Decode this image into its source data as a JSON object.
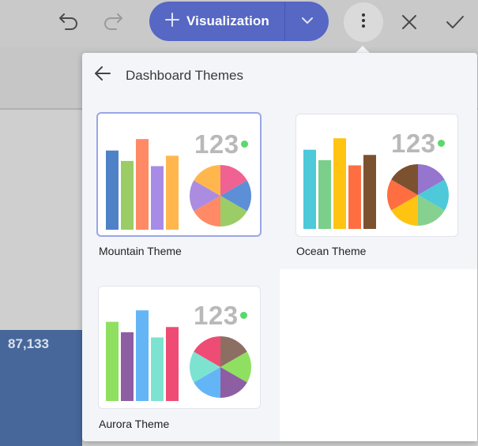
{
  "background": {
    "kpi_value": "87,133"
  },
  "toolbar": {
    "undo_icon": "undo-icon",
    "redo_icon": "redo-icon",
    "visualization_label": "Visualization",
    "more_icon": "more-vertical-icon",
    "close_icon": "close-icon",
    "confirm_icon": "check-icon",
    "accent": "#5667c4"
  },
  "panel": {
    "title": "Dashboard Themes",
    "back_icon": "arrow-left-icon",
    "themes": [
      {
        "label": "Mountain Theme",
        "selected": true,
        "number": "123",
        "bar_colors": [
          "#4f81c7",
          "#9ccc65",
          "#ff8a65",
          "#a78be6",
          "#ffb74d"
        ],
        "bar_values": [
          0.76,
          0.66,
          0.87,
          0.61,
          0.71
        ],
        "pie_colors": [
          "#f06292",
          "#5c8fd6",
          "#9ccc65",
          "#ff8a65",
          "#ab8ce0",
          "#ffb74d"
        ]
      },
      {
        "label": "Ocean Theme",
        "selected": false,
        "number": "123",
        "bar_colors": [
          "#4dc9d9",
          "#7ccf8a",
          "#ffc412",
          "#ff6e40",
          "#7b5130"
        ],
        "bar_values": [
          0.76,
          0.66,
          0.87,
          0.61,
          0.71
        ],
        "pie_colors": [
          "#9575cd",
          "#4dc9d9",
          "#86d18f",
          "#ffc412",
          "#ff6e40",
          "#7b5130"
        ]
      },
      {
        "label": "Aurora Theme",
        "selected": false,
        "number": "123",
        "bar_colors": [
          "#8fe060",
          "#8e5ea2",
          "#64b5f6",
          "#7de3d1",
          "#ee4c74"
        ],
        "bar_values": [
          0.76,
          0.66,
          0.87,
          0.61,
          0.71
        ],
        "pie_colors": [
          "#8d6e63",
          "#8fe060",
          "#8e5ea2",
          "#64b5f6",
          "#7de3d1",
          "#ee4c74"
        ]
      }
    ]
  }
}
